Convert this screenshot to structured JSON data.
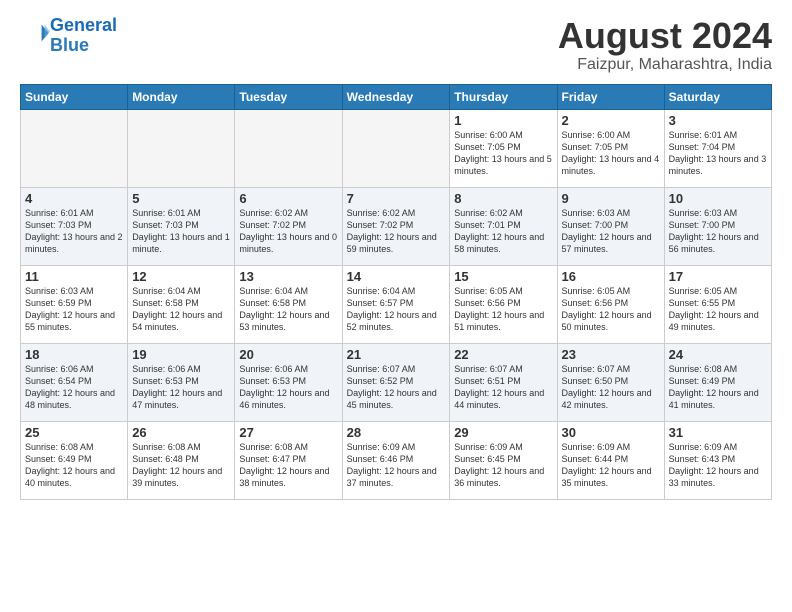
{
  "logo": {
    "line1": "General",
    "line2": "Blue"
  },
  "title": "August 2024",
  "subtitle": "Faizpur, Maharashtra, India",
  "days_of_week": [
    "Sunday",
    "Monday",
    "Tuesday",
    "Wednesday",
    "Thursday",
    "Friday",
    "Saturday"
  ],
  "weeks": [
    [
      {
        "day": "",
        "empty": true
      },
      {
        "day": "",
        "empty": true
      },
      {
        "day": "",
        "empty": true
      },
      {
        "day": "",
        "empty": true
      },
      {
        "day": "1",
        "sunrise": "6:00 AM",
        "sunset": "7:05 PM",
        "daylight": "13 hours and 5 minutes."
      },
      {
        "day": "2",
        "sunrise": "6:00 AM",
        "sunset": "7:05 PM",
        "daylight": "13 hours and 4 minutes."
      },
      {
        "day": "3",
        "sunrise": "6:01 AM",
        "sunset": "7:04 PM",
        "daylight": "13 hours and 3 minutes."
      }
    ],
    [
      {
        "day": "4",
        "sunrise": "6:01 AM",
        "sunset": "7:03 PM",
        "daylight": "13 hours and 2 minutes."
      },
      {
        "day": "5",
        "sunrise": "6:01 AM",
        "sunset": "7:03 PM",
        "daylight": "13 hours and 1 minute."
      },
      {
        "day": "6",
        "sunrise": "6:02 AM",
        "sunset": "7:02 PM",
        "daylight": "13 hours and 0 minutes."
      },
      {
        "day": "7",
        "sunrise": "6:02 AM",
        "sunset": "7:02 PM",
        "daylight": "12 hours and 59 minutes."
      },
      {
        "day": "8",
        "sunrise": "6:02 AM",
        "sunset": "7:01 PM",
        "daylight": "12 hours and 58 minutes."
      },
      {
        "day": "9",
        "sunrise": "6:03 AM",
        "sunset": "7:00 PM",
        "daylight": "12 hours and 57 minutes."
      },
      {
        "day": "10",
        "sunrise": "6:03 AM",
        "sunset": "7:00 PM",
        "daylight": "12 hours and 56 minutes."
      }
    ],
    [
      {
        "day": "11",
        "sunrise": "6:03 AM",
        "sunset": "6:59 PM",
        "daylight": "12 hours and 55 minutes."
      },
      {
        "day": "12",
        "sunrise": "6:04 AM",
        "sunset": "6:58 PM",
        "daylight": "12 hours and 54 minutes."
      },
      {
        "day": "13",
        "sunrise": "6:04 AM",
        "sunset": "6:58 PM",
        "daylight": "12 hours and 53 minutes."
      },
      {
        "day": "14",
        "sunrise": "6:04 AM",
        "sunset": "6:57 PM",
        "daylight": "12 hours and 52 minutes."
      },
      {
        "day": "15",
        "sunrise": "6:05 AM",
        "sunset": "6:56 PM",
        "daylight": "12 hours and 51 minutes."
      },
      {
        "day": "16",
        "sunrise": "6:05 AM",
        "sunset": "6:56 PM",
        "daylight": "12 hours and 50 minutes."
      },
      {
        "day": "17",
        "sunrise": "6:05 AM",
        "sunset": "6:55 PM",
        "daylight": "12 hours and 49 minutes."
      }
    ],
    [
      {
        "day": "18",
        "sunrise": "6:06 AM",
        "sunset": "6:54 PM",
        "daylight": "12 hours and 48 minutes."
      },
      {
        "day": "19",
        "sunrise": "6:06 AM",
        "sunset": "6:53 PM",
        "daylight": "12 hours and 47 minutes."
      },
      {
        "day": "20",
        "sunrise": "6:06 AM",
        "sunset": "6:53 PM",
        "daylight": "12 hours and 46 minutes."
      },
      {
        "day": "21",
        "sunrise": "6:07 AM",
        "sunset": "6:52 PM",
        "daylight": "12 hours and 45 minutes."
      },
      {
        "day": "22",
        "sunrise": "6:07 AM",
        "sunset": "6:51 PM",
        "daylight": "12 hours and 44 minutes."
      },
      {
        "day": "23",
        "sunrise": "6:07 AM",
        "sunset": "6:50 PM",
        "daylight": "12 hours and 42 minutes."
      },
      {
        "day": "24",
        "sunrise": "6:08 AM",
        "sunset": "6:49 PM",
        "daylight": "12 hours and 41 minutes."
      }
    ],
    [
      {
        "day": "25",
        "sunrise": "6:08 AM",
        "sunset": "6:49 PM",
        "daylight": "12 hours and 40 minutes."
      },
      {
        "day": "26",
        "sunrise": "6:08 AM",
        "sunset": "6:48 PM",
        "daylight": "12 hours and 39 minutes."
      },
      {
        "day": "27",
        "sunrise": "6:08 AM",
        "sunset": "6:47 PM",
        "daylight": "12 hours and 38 minutes."
      },
      {
        "day": "28",
        "sunrise": "6:09 AM",
        "sunset": "6:46 PM",
        "daylight": "12 hours and 37 minutes."
      },
      {
        "day": "29",
        "sunrise": "6:09 AM",
        "sunset": "6:45 PM",
        "daylight": "12 hours and 36 minutes."
      },
      {
        "day": "30",
        "sunrise": "6:09 AM",
        "sunset": "6:44 PM",
        "daylight": "12 hours and 35 minutes."
      },
      {
        "day": "31",
        "sunrise": "6:09 AM",
        "sunset": "6:43 PM",
        "daylight": "12 hours and 33 minutes."
      }
    ]
  ]
}
